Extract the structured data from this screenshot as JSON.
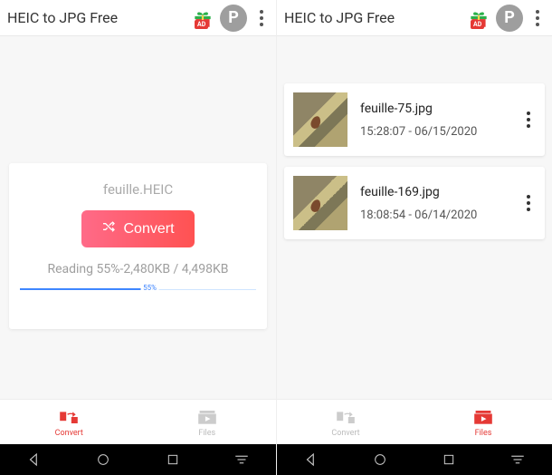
{
  "header": {
    "title": "HEIC to JPG Free",
    "p_label": "P",
    "ad_label": "AD"
  },
  "convert": {
    "filename": "feuille.HEIC",
    "button_label": "Convert",
    "status_prefix": "Reading ",
    "percent": 55,
    "read_kb": "2,480KB",
    "total_kb": "4,498KB",
    "status_line": "Reading 55%-2,480KB / 4,498KB",
    "pct_label": "55%"
  },
  "files": [
    {
      "name": "feuille-75.jpg",
      "ts": "15:28:07 - 06/15/2020"
    },
    {
      "name": "feuille-169.jpg",
      "ts": "18:08:54 - 06/14/2020"
    }
  ],
  "tabs": {
    "convert": "Convert",
    "files": "Files"
  }
}
